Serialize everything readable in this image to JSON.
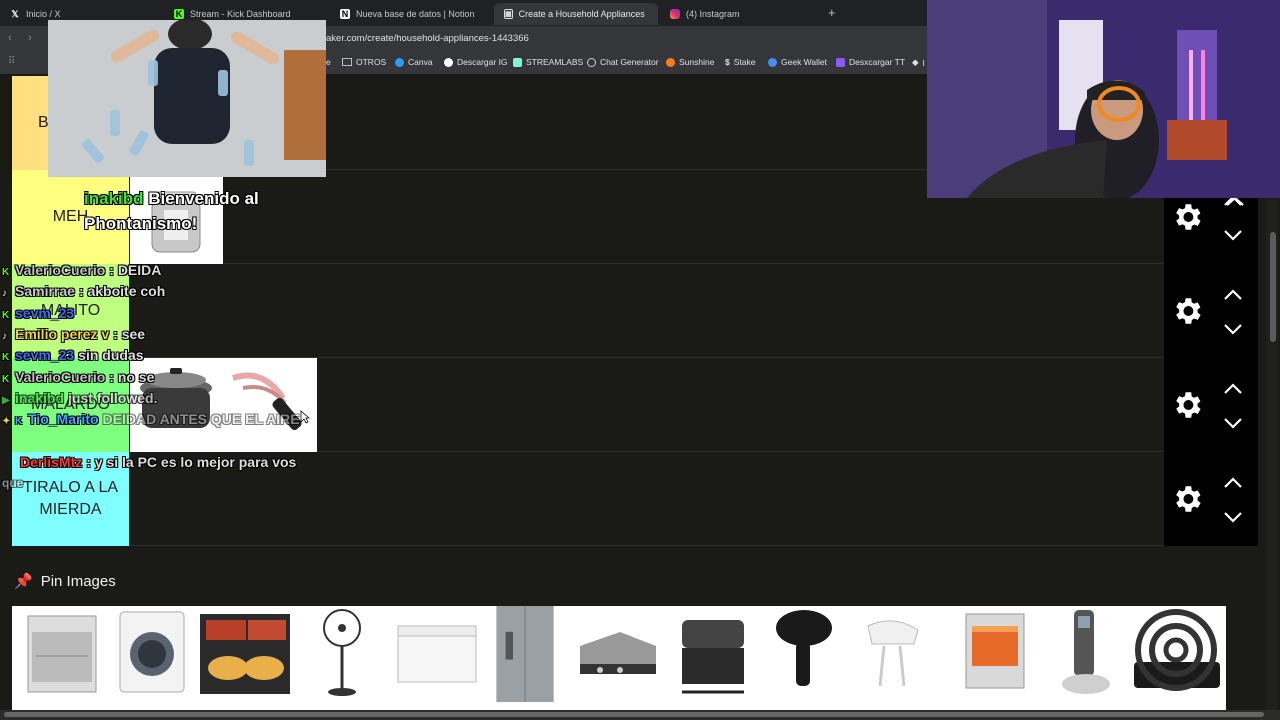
{
  "tabs": [
    {
      "label": "Inicio / X",
      "icon": "x-logo-icon"
    },
    {
      "label": "Stream - Kick Dashboard",
      "icon": "kick-logo-icon"
    },
    {
      "label": "Nueva base de datos | Notion",
      "icon": "notion-logo-icon"
    },
    {
      "label": "Create a Household Appliances",
      "icon": "tiermaker-icon",
      "active": true
    },
    {
      "label": "(4) Instagram",
      "icon": "instagram-icon"
    }
  ],
  "address": {
    "url": "aker.com/create/household-appliances-1443366"
  },
  "bookmarks": [
    {
      "label": "e",
      "color": "#888888"
    },
    {
      "label": "OTROS",
      "color": "#bbbbbb"
    },
    {
      "label": "Canva",
      "color": "#2a9df4"
    },
    {
      "label": "Descargar IG",
      "color": "#ffffff"
    },
    {
      "label": "STREAMLABS",
      "color": "#80f5d2"
    },
    {
      "label": "Chat Generator",
      "color": "#cccccc"
    },
    {
      "label": "Sunshine",
      "color": "#ff7a1a"
    },
    {
      "label": "Stake",
      "color": "#ffffff"
    },
    {
      "label": "Geek Wallet",
      "color": "#4a8df0"
    },
    {
      "label": "Desxcargar TT",
      "color": "#8a5cf5"
    },
    {
      "label": "I",
      "color": "#ffffff"
    }
  ],
  "tiers": [
    {
      "label": "B",
      "color": "#ffdf80"
    },
    {
      "label": "MEH",
      "color": "#ffff7f"
    },
    {
      "label": "MALITO",
      "color": "#bfff7f"
    },
    {
      "label": "MALARDO",
      "color": "#7fff7f"
    },
    {
      "label": "TIRALO A LA MIERDA",
      "color": "#7fffff"
    }
  ],
  "pin": {
    "title": "Pin Images",
    "icon": "pushpin-icon"
  },
  "welcome": {
    "user": "inakibd",
    "text": "Bienvenido al Phontanismo!"
  },
  "chat": [
    {
      "platform": "kick",
      "user": "ValerioCuerio",
      "text": ": DEIDA",
      "color": "#c0c0c0"
    },
    {
      "platform": "tiktok",
      "user": "Samirrae",
      "text": ": akboite coh",
      "color": "#c9c9c9"
    },
    {
      "platform": "kick",
      "user": "sevm_23",
      "text": "",
      "color": "#3b6bff"
    },
    {
      "platform": "tiktok",
      "user": "Emilio perez v",
      "text": ": see",
      "color": "#f2d34a"
    },
    {
      "platform": "kick",
      "user": "sevm_23",
      "text": "sin dudas",
      "color": "#3b6bff"
    },
    {
      "platform": "kick",
      "user": "ValerioCuerio",
      "text": ": no se",
      "color": "#c0c0c0"
    },
    {
      "platform": "youtube",
      "user": "inakibd",
      "text": "just followed.",
      "color": "#3fe03f"
    },
    {
      "platform": "kick",
      "user": "Tio_Marito",
      "text": "DEIDAD ANTES QUE EL AIRE",
      "color": "#4aa8ff"
    },
    {
      "platform": "kick",
      "user": "DerlisMtz",
      "text": ": y si la PC es lo mejor para vos",
      "color": "#ff3b3b"
    },
    {
      "platform": "kick",
      "user": "",
      "text": "que",
      "color": "#cccccc"
    }
  ],
  "thumbs": [
    "dishwasher",
    "washing-machine",
    "griddle",
    "fan",
    "chest-freezer",
    "refrigerator",
    "contact-grill",
    "gas-grill",
    "hair-dryer",
    "hand-mixer",
    "space-heater",
    "cordless-phone",
    "hot-plate"
  ]
}
